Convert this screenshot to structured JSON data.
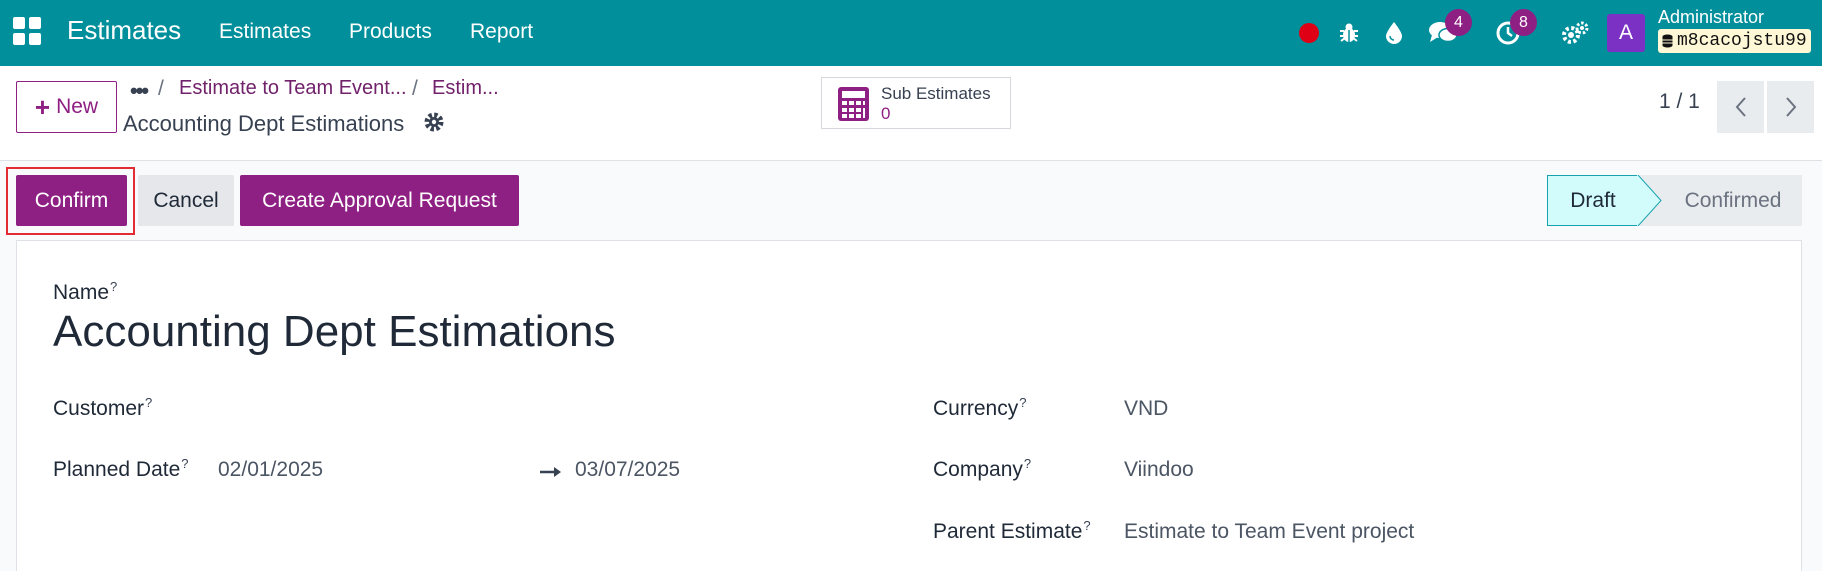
{
  "app": {
    "title": "Estimates",
    "menus": [
      "Estimates",
      "Products",
      "Report"
    ]
  },
  "systray": {
    "messages_count": "4",
    "activities_count": "8",
    "avatar_letter": "A",
    "user_name": "Administrator",
    "database": "m8cacojstu99",
    "icons": [
      "recording-dot-icon",
      "bug-icon",
      "drop-icon",
      "chat-icon",
      "clock-icon",
      "settings-icon"
    ]
  },
  "control_panel": {
    "new_label": "New",
    "breadcrumbs": [
      "Estimate to Team Event...",
      "Estim..."
    ],
    "record_title": "Accounting Dept Estimations",
    "smart_button": {
      "label": "Sub Estimates",
      "value": "0"
    },
    "pager": "1 / 1"
  },
  "statusbar": {
    "buttons": [
      "Confirm",
      "Cancel",
      "Create Approval Request"
    ],
    "stages": [
      "Draft",
      "Confirmed"
    ],
    "active_stage": "Draft"
  },
  "form": {
    "name_label": "Name",
    "name_value": "Accounting Dept Estimations",
    "customer_label": "Customer",
    "customer_value": "",
    "planned_date_label": "Planned Date",
    "planned_date_start": "02/01/2025",
    "planned_date_end": "03/07/2025",
    "currency_label": "Currency",
    "currency_value": "VND",
    "company_label": "Company",
    "company_value": "Viindoo",
    "parent_label": "Parent Estimate",
    "parent_value": "Estimate to Team Event project",
    "help_mark": "?"
  },
  "colors": {
    "navbar": "#018f9b",
    "primary": "#8e1f83",
    "highlight": "#e32b33",
    "active_stage": "#d2fbfc"
  }
}
